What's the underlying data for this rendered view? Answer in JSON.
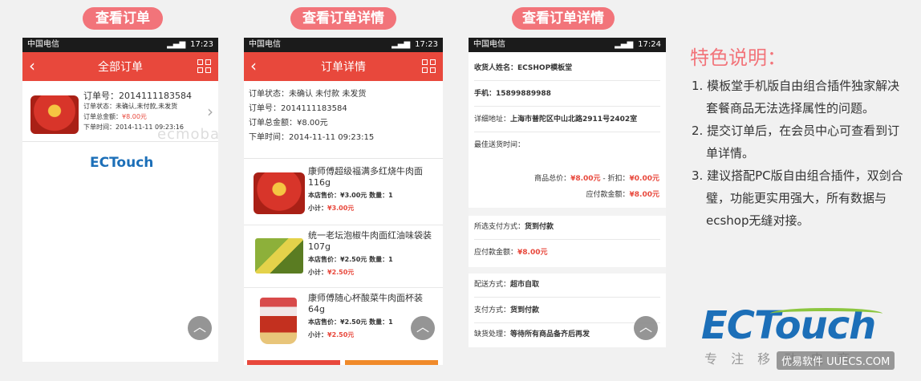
{
  "labels": {
    "pill1": "查看订单",
    "pill2": "查看订单详情",
    "pill3": "查看订单详情"
  },
  "status": {
    "carrier": "中国电信",
    "time1": "17:23",
    "time2": "17:23",
    "time3": "17:24"
  },
  "screen1": {
    "title": "全部订单",
    "order_no": "订单号：2014111183584",
    "order_status": "订单状态：未确认,未付款,未发货",
    "order_total_label": "订单总金额：",
    "order_total": "¥8.00元",
    "order_time": "下单时间：2014-11-11 09:23:16",
    "watermark": "ecmoban",
    "logo": "ECTouch"
  },
  "screen2": {
    "title": "订单详情",
    "status": "订单状态：未确认 未付款 未发货",
    "order_no": "订单号：2014111183584",
    "total": "订单总金额：¥8.00元",
    "time": "下单时间：2014-11-11 09:23:15",
    "items": [
      {
        "name": "康师傅超级福满多红烧牛肉面116g",
        "price": "本店售价：¥3.00元 数量：1",
        "subtotal_label": "小计：",
        "subtotal": "¥3.00元"
      },
      {
        "name": "统一老坛泡椒牛肉面红油味袋装107g",
        "price": "本店售价：¥2.50元 数量：1",
        "subtotal_label": "小计：",
        "subtotal": "¥2.50元"
      },
      {
        "name": "康师傅随心杯酸菜牛肉面杯装64g",
        "price": "本店售价：¥2.50元 数量：1",
        "subtotal_label": "小计：",
        "subtotal": "¥2.50元"
      }
    ]
  },
  "screen3": {
    "consignee": "收货人姓名：ECSHOP模板堂",
    "mobile": "手机：15899889988",
    "address_label": "详细地址：",
    "address": "上海市普陀区中山北路2911号2402室",
    "best_time": "最佳送货时间：",
    "goods_total_label": "商品总价：",
    "goods_total": "¥8.00元",
    "discount_label": " - 折扣：",
    "discount": "¥0.00元",
    "payable_label": "应付款金额：",
    "payable": "¥8.00元",
    "payment_label": "所选支付方式：",
    "payment": "货到付款",
    "payable2_label": "应付款金额：",
    "payable2": "¥8.00元",
    "shipping_label": "配送方式：",
    "shipping": "超市自取",
    "pay_label": "支付方式：",
    "pay": "货到付款",
    "stockout_label": "缺货处理：",
    "stockout": "等待所有商品备齐后再发"
  },
  "features": {
    "title": "特色说明：",
    "items": [
      "1. 模板堂手机版自由组合插件独家解决套餐商品无法选择属性的问题。",
      "2. 提交订单后，在会员中心可查看到订单详情。",
      "3. 建议搭配PC版自由组合插件，双剑合璧，功能更实用强大，所有数据与ecshop无缝对接。"
    ]
  },
  "brand": {
    "logo": "ECTouch",
    "slogan": "专 注 移 动 电 商",
    "watermark": "优易软件 UUECS.COM"
  },
  "colors": {
    "accent": "#e8483c",
    "pill": "#f2747a",
    "logo_blue": "#1c6fb8",
    "logo_green": "#8cc63f"
  }
}
